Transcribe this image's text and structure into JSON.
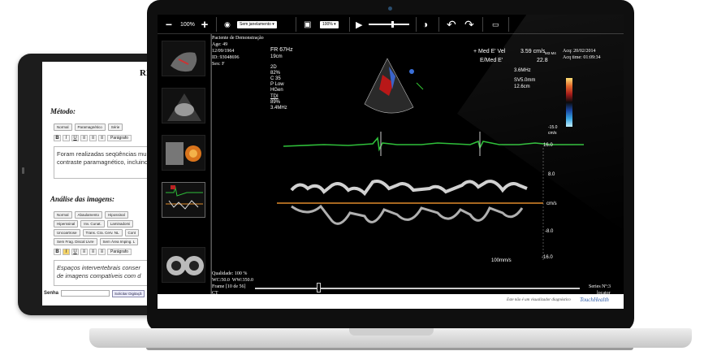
{
  "tablet": {
    "title": "RE",
    "metodo": "Método:",
    "metodo_buttons": [
      "Normal",
      "Paramagnético",
      "Série"
    ],
    "toolbar": {
      "b": "B",
      "i": "I",
      "u": "U",
      "para": "Parágrafo"
    },
    "text1_l1": "Foram realizadas seqüências mu",
    "text1_l2": "contraste paramagnético, incluind",
    "analise": "Análise das imagens:",
    "analise_row1": [
      "Normal",
      "Abaulamento",
      "Hipossinal"
    ],
    "analise_row2": [
      "Hiperssinal",
      "Inv. Cunat.",
      "Laminadomi"
    ],
    "analise_row3": [
      "Uncoartrose",
      "Trans. Cra. Cerv. NL",
      "Cont"
    ],
    "analise_row4": [
      "Sem Frag. Discal Livre",
      "Sem Área Imping. L"
    ],
    "text2_l1": "Espaços intervertebrais conser",
    "text2_l2": "de imagens compatíveis com d",
    "senha": "Senha",
    "solicitar": "Solicitar Digitaçã"
  },
  "toolbar": {
    "zoom": "100%",
    "sem_janelamento": "Sem janelamento",
    "zoom2": "100%"
  },
  "overlay": {
    "patient_name": "Paciente de Demonstração",
    "age": "Age: 49",
    "dob": "12/09/1964",
    "id": "ID: 93048696",
    "sex": "Sex: F",
    "acq_date": "Acq: 20/02/2014",
    "acq_time": "Acq time: 01:09:34",
    "fr": "FR 67Hz",
    "depth": "19cm",
    "mode_block": "2D\n82%\nC 35\nP Low\nHGen",
    "tdi_label": "TDI",
    "tdi_block": "89%\n3.4MHz",
    "med_vel_label": "+ Med E' Vel",
    "med_vel_value": "3.59 cm/s",
    "e_med_label": "E/Med E'",
    "e_med_value": "22.8",
    "freq": "3.6MHz",
    "sv": "SV5.0mm",
    "sv_depth": "12.6cm",
    "colorbar_top": "M3 M4",
    "colorbar_hi": "15.0",
    "colorbar_lo": "-15.0",
    "colorbar_unit": "cm/s",
    "scale_ticks": [
      "16.0",
      "8.0",
      "cm/s",
      "-8.0",
      "-16.0"
    ],
    "speed": "100mm/s",
    "qualidade": "Qualidade: 100 %",
    "wc_ww": "WC:50.0  WW:350.0",
    "frame": "Frame [10 de 56]",
    "modality": "CT",
    "series": "Series Nº:3",
    "locator": "locator"
  },
  "footer": {
    "disclaimer": "Este não é um visualizador diagnóstico",
    "logo": "TouchHealth"
  },
  "colors": {
    "ecg": "#2fbf3a",
    "baseline": "#e08a2a",
    "doppler": "#e8e8e8"
  }
}
